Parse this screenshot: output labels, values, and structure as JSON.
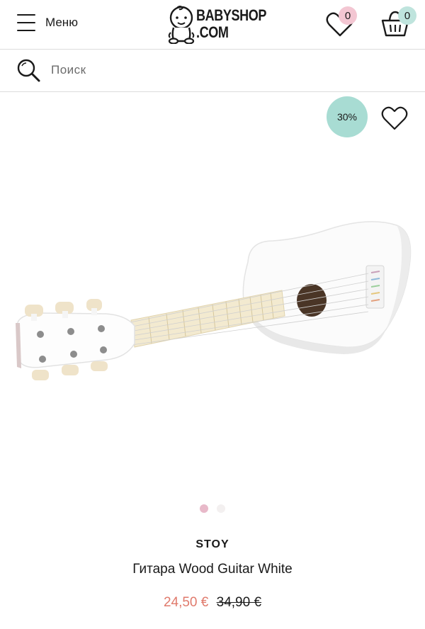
{
  "header": {
    "menu_label": "Меню",
    "logo_line1": "BABYSHOP",
    "logo_line2": ".COM",
    "wishlist_count": "0",
    "cart_count": "0"
  },
  "search": {
    "placeholder": "Поиск"
  },
  "product": {
    "discount": "30%",
    "brand": "STOY",
    "title": "Гитара Wood Guitar White",
    "price": "24,50 €",
    "old_price": "34,90 €",
    "image_count": 2,
    "active_image": 1
  },
  "icons": {
    "menu": "hamburger-icon",
    "logo": "baby-logo-icon",
    "wishlist": "heart-icon",
    "cart": "basket-icon",
    "search": "search-icon",
    "favorite": "heart-icon"
  },
  "colors": {
    "discount_badge": "#a8dcd3",
    "wishlist_badge": "#f3c6d2",
    "cart_badge": "#bfe4dd",
    "sale_price": "#e07a6c",
    "active_dot": "#e8b9c9"
  }
}
